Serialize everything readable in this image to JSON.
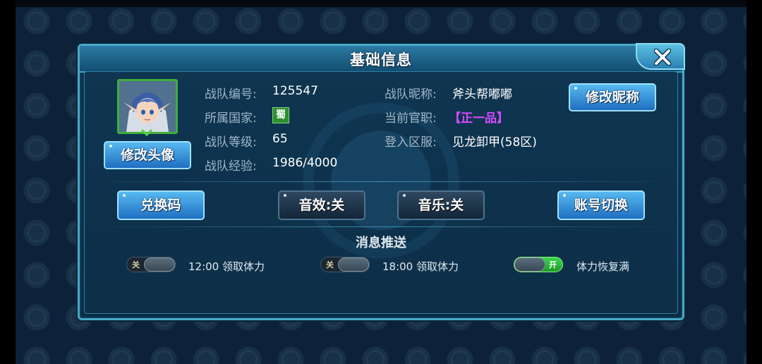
{
  "dialog": {
    "title": "基础信息",
    "close_icon": "close-icon"
  },
  "profile": {
    "avatar_icon": "hero-portrait",
    "change_avatar_label": "修改头像",
    "change_nickname_label": "修改昵称",
    "fields": {
      "team_id_label": "战队编号:",
      "team_id_value": "125547",
      "nation_label": "所属国家:",
      "nation_value": "蜀",
      "team_level_label": "战队等级:",
      "team_level_value": "65",
      "team_exp_label": "战队经验:",
      "team_exp_value": "1986/4000",
      "nickname_label": "战队昵称:",
      "nickname_value": "斧头帮嘟嘟",
      "rank_label": "当前官职:",
      "rank_value": "【正一品】",
      "server_label": "登入区服:",
      "server_value": "见龙卸甲(58区)"
    }
  },
  "actions": {
    "redeem_code": "兑换码",
    "sound_effect": "音效:关",
    "music": "音乐:关",
    "switch_account": "账号切换"
  },
  "push": {
    "title": "消息推送",
    "items": [
      {
        "state_text": "关",
        "label": "12:00  领取体力",
        "on": false
      },
      {
        "state_text": "关",
        "label": "18:00  领取体力",
        "on": false
      },
      {
        "state_text": "开",
        "label": "体力恢复满",
        "on": true
      }
    ]
  },
  "colors": {
    "panel_border": "#4aa9c6",
    "button_blue": "#3f97dc",
    "rank_purple": "#d64bff",
    "toggle_on": "#2fbd3c"
  }
}
